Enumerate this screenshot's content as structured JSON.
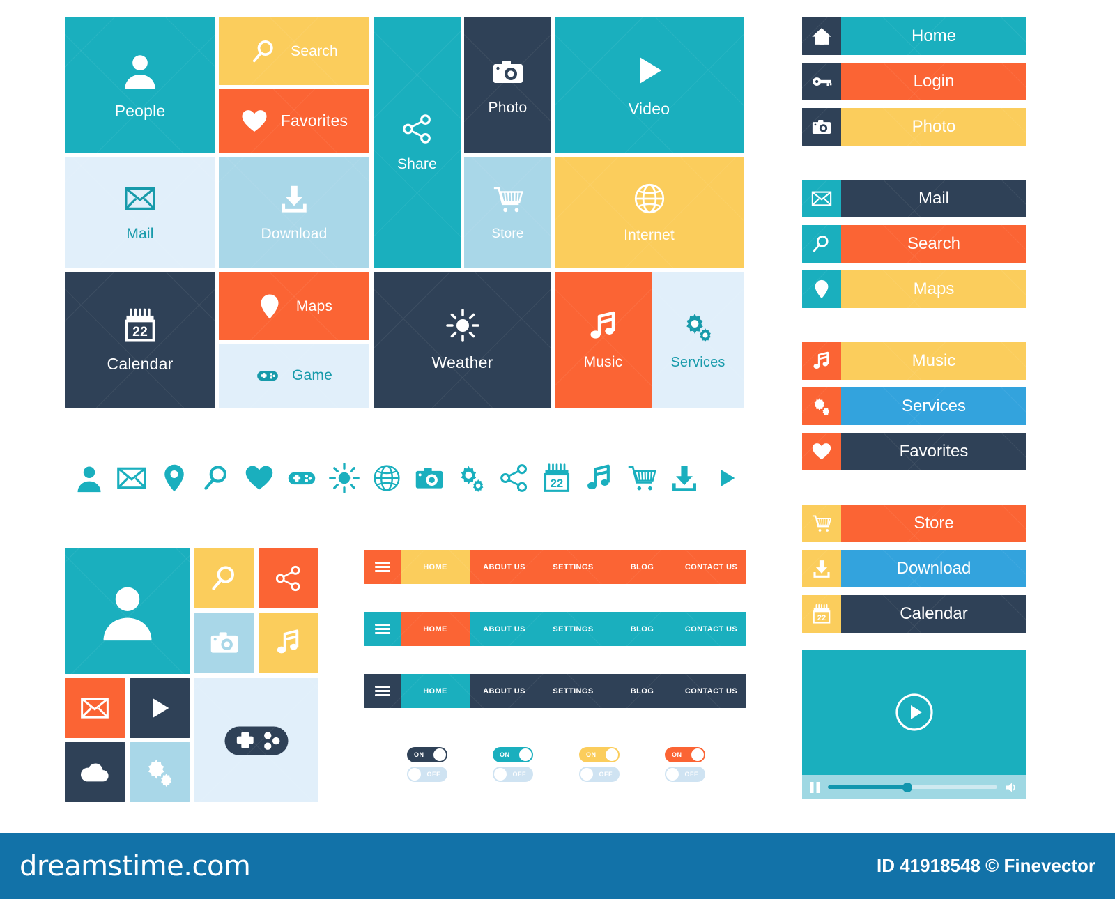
{
  "palette": {
    "teal": "#1aafbe",
    "teal_dark": "#149aaa",
    "yellow": "#fbcd5c",
    "orange": "#fb6434",
    "navy": "#2f4157",
    "pale_blue": "#e1effa",
    "light_blue": "#a9d7e8",
    "blue": "#33a3dd",
    "white": "#ffffff",
    "footer_blue": "#1272a8"
  },
  "main_tiles": [
    {
      "label": "People",
      "icon": "person-icon",
      "layout": "vertical",
      "bg": "#1aafbe",
      "fg": "#ffffff"
    },
    {
      "label": "Search",
      "icon": "search-icon",
      "layout": "horizontal",
      "bg": "#fbcd5c",
      "fg": "#ffffff"
    },
    {
      "label": "Favorites",
      "icon": "heart-icon",
      "layout": "horizontal",
      "bg": "#fb6434",
      "fg": "#ffffff"
    },
    {
      "label": "Share",
      "icon": "share-icon",
      "layout": "vertical",
      "bg": "#1aafbe",
      "fg": "#ffffff"
    },
    {
      "label": "Photo",
      "icon": "camera-icon",
      "layout": "vertical",
      "bg": "#2f4157",
      "fg": "#ffffff"
    },
    {
      "label": "Video",
      "icon": "play-icon",
      "layout": "vertical",
      "bg": "#1aafbe",
      "fg": "#ffffff"
    },
    {
      "label": "Mail",
      "icon": "mail-icon",
      "layout": "vertical",
      "bg": "#e1effa",
      "fg": "#179aaa"
    },
    {
      "label": "Download",
      "icon": "download-icon",
      "layout": "vertical",
      "bg": "#a9d7e8",
      "fg": "#ffffff"
    },
    {
      "label": "Store",
      "icon": "cart-icon",
      "layout": "vertical",
      "bg": "#a9d7e8",
      "fg": "#ffffff"
    },
    {
      "label": "Internet",
      "icon": "globe-icon",
      "layout": "vertical",
      "bg": "#fbcd5c",
      "fg": "#ffffff"
    },
    {
      "label": "Calendar",
      "icon": "calendar-icon",
      "layout": "vertical",
      "bg": "#2f4157",
      "fg": "#ffffff"
    },
    {
      "label": "Maps",
      "icon": "pin-icon",
      "layout": "horizontal",
      "bg": "#fb6434",
      "fg": "#ffffff"
    },
    {
      "label": "Game",
      "icon": "gamepad-icon",
      "layout": "horizontal",
      "bg": "#e1effa",
      "fg": "#179aaa"
    },
    {
      "label": "Weather",
      "icon": "sun-icon",
      "layout": "vertical",
      "bg": "#2f4157",
      "fg": "#ffffff"
    },
    {
      "label": "Music",
      "icon": "note-icon",
      "layout": "vertical",
      "bg": "#fb6434",
      "fg": "#ffffff"
    },
    {
      "label": "Services",
      "icon": "gears-icon",
      "layout": "vertical",
      "bg": "#e1effa",
      "fg": "#179aaa"
    }
  ],
  "icon_strip": {
    "color": "#1aafbe",
    "icons": [
      "person-icon",
      "mail-icon",
      "pin-icon",
      "search-icon",
      "heart-icon",
      "gamepad-icon",
      "sun-icon",
      "globe-icon",
      "camera-icon",
      "gears-icon",
      "share-icon",
      "calendar-icon",
      "note-icon",
      "cart-icon",
      "download-icon",
      "play-icon"
    ]
  },
  "collage": {
    "tiles": [
      {
        "icon": "person-icon",
        "bg": "#1aafbe",
        "fg": "#ffffff"
      },
      {
        "icon": "search-icon",
        "bg": "#fbcd5c",
        "fg": "#ffffff"
      },
      {
        "icon": "share-icon",
        "bg": "#fb6434",
        "fg": "#ffffff"
      },
      {
        "icon": "camera-icon",
        "bg": "#a9d7e8",
        "fg": "#ffffff"
      },
      {
        "icon": "note-icon",
        "bg": "#fbcd5c",
        "fg": "#ffffff"
      },
      {
        "icon": "mail-icon",
        "bg": "#fb6434",
        "fg": "#ffffff"
      },
      {
        "icon": "play-icon",
        "bg": "#2f4157",
        "fg": "#ffffff"
      },
      {
        "icon": "gamepad-icon",
        "bg": "#e1effa",
        "fg": "#2f4157"
      },
      {
        "icon": "cloud-icon",
        "bg": "#2f4157",
        "fg": "#ffffff"
      },
      {
        "icon": "gears-icon",
        "bg": "#a9d7e8",
        "fg": "#ffffff"
      }
    ]
  },
  "sidebar_groups": [
    {
      "buttons": [
        {
          "label": "Home",
          "icon": "home-icon",
          "icon_bg": "#2f4157",
          "body_bg": "#1aafbe",
          "fg": "#ffffff"
        },
        {
          "label": "Login",
          "icon": "key-icon",
          "icon_bg": "#2f4157",
          "body_bg": "#fb6434",
          "fg": "#ffffff"
        },
        {
          "label": "Photo",
          "icon": "camera-icon",
          "icon_bg": "#2f4157",
          "body_bg": "#fbcd5c",
          "fg": "#ffffff"
        }
      ]
    },
    {
      "buttons": [
        {
          "label": "Mail",
          "icon": "mail-icon",
          "icon_bg": "#1aafbe",
          "body_bg": "#2f4157",
          "fg": "#ffffff"
        },
        {
          "label": "Search",
          "icon": "search-icon",
          "icon_bg": "#1aafbe",
          "body_bg": "#fb6434",
          "fg": "#ffffff"
        },
        {
          "label": "Maps",
          "icon": "pin-icon",
          "icon_bg": "#1aafbe",
          "body_bg": "#fbcd5c",
          "fg": "#ffffff"
        }
      ]
    },
    {
      "buttons": [
        {
          "label": "Music",
          "icon": "note-icon",
          "icon_bg": "#fb6434",
          "body_bg": "#fbcd5c",
          "fg": "#ffffff"
        },
        {
          "label": "Services",
          "icon": "gears-icon",
          "icon_bg": "#fb6434",
          "body_bg": "#33a3dd",
          "fg": "#ffffff"
        },
        {
          "label": "Favorites",
          "icon": "heart-icon",
          "icon_bg": "#fb6434",
          "body_bg": "#2f4157",
          "fg": "#ffffff"
        }
      ]
    },
    {
      "buttons": [
        {
          "label": "Store",
          "icon": "cart-icon",
          "icon_bg": "#fbcd5c",
          "body_bg": "#fb6434",
          "fg": "#ffffff"
        },
        {
          "label": "Download",
          "icon": "download-icon",
          "icon_bg": "#fbcd5c",
          "body_bg": "#33a3dd",
          "fg": "#ffffff"
        },
        {
          "label": "Calendar",
          "icon": "calendar-icon",
          "icon_bg": "#fbcd5c",
          "body_bg": "#2f4157",
          "fg": "#ffffff"
        }
      ]
    }
  ],
  "navbars": [
    {
      "burger_bg": "#fb6434",
      "bar_bg": "#fb6434",
      "items": [
        {
          "label": "HOME",
          "bg": "#fbcd5c",
          "fg": "#ffffff",
          "active": true
        },
        {
          "label": "ABOUT US",
          "bg": "#fb6434",
          "fg": "#ffffff",
          "active": false
        },
        {
          "label": "SETTINGS",
          "bg": "#fb6434",
          "fg": "#ffffff",
          "active": false
        },
        {
          "label": "BLOG",
          "bg": "#fb6434",
          "fg": "#ffffff",
          "active": false
        },
        {
          "label": "CONTACT US",
          "bg": "#fb6434",
          "fg": "#ffffff",
          "active": false
        }
      ]
    },
    {
      "burger_bg": "#1aafbe",
      "bar_bg": "#1aafbe",
      "items": [
        {
          "label": "HOME",
          "bg": "#fb6434",
          "fg": "#ffffff",
          "active": true
        },
        {
          "label": "ABOUT US",
          "bg": "#1aafbe",
          "fg": "#ffffff",
          "active": false
        },
        {
          "label": "SETTINGS",
          "bg": "#1aafbe",
          "fg": "#ffffff",
          "active": false
        },
        {
          "label": "BLOG",
          "bg": "#1aafbe",
          "fg": "#ffffff",
          "active": false
        },
        {
          "label": "CONTACT US",
          "bg": "#1aafbe",
          "fg": "#ffffff",
          "active": false
        }
      ]
    },
    {
      "burger_bg": "#2f4157",
      "bar_bg": "#2f4157",
      "items": [
        {
          "label": "HOME",
          "bg": "#1aafbe",
          "fg": "#ffffff",
          "active": true
        },
        {
          "label": "ABOUT US",
          "bg": "#2f4157",
          "fg": "#ffffff",
          "active": false
        },
        {
          "label": "SETTINGS",
          "bg": "#2f4157",
          "fg": "#ffffff",
          "active": false
        },
        {
          "label": "BLOG",
          "bg": "#2f4157",
          "fg": "#ffffff",
          "active": false
        },
        {
          "label": "CONTACT US",
          "bg": "#2f4157",
          "fg": "#ffffff",
          "active": false
        }
      ]
    }
  ],
  "toggles": [
    {
      "on_label": "ON",
      "off_label": "OFF",
      "on_bg": "#2f4157",
      "on_fg": "#ffffff",
      "off_bg": "#cfe3f2",
      "off_fg": "#ffffff"
    },
    {
      "on_label": "ON",
      "off_label": "OFF",
      "on_bg": "#1aafbe",
      "on_fg": "#ffffff",
      "off_bg": "#cfe3f2",
      "off_fg": "#ffffff"
    },
    {
      "on_label": "ON",
      "off_label": "OFF",
      "on_bg": "#fbcd5c",
      "on_fg": "#ffffff",
      "off_bg": "#cfe3f2",
      "off_fg": "#ffffff"
    },
    {
      "on_label": "ON",
      "off_label": "OFF",
      "on_bg": "#fb6434",
      "on_fg": "#ffffff",
      "off_bg": "#cfe3f2",
      "off_fg": "#ffffff"
    }
  ],
  "player": {
    "screen_bg": "#1aafbe",
    "control_bg": "#9fd8e3",
    "play_icon": "play-circle-icon",
    "pause_icon": "pause-icon",
    "volume_icon": "volume-icon",
    "progress_percent": 47
  },
  "footer": {
    "watermark": "dreamstime.com",
    "credit": "ID 41918548 © Finevector"
  }
}
